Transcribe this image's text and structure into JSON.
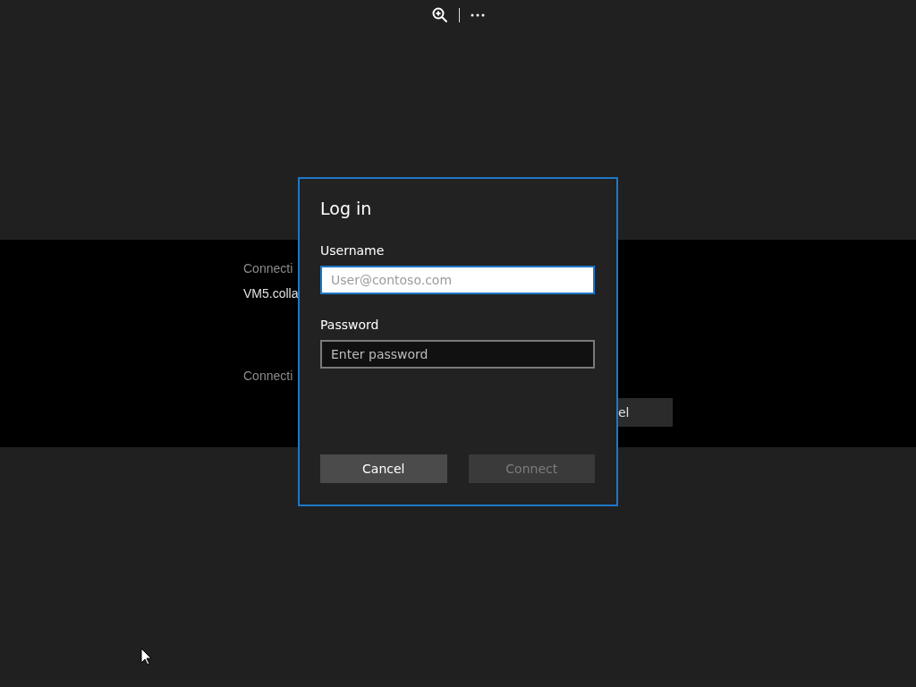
{
  "background": {
    "texts": [
      {
        "text": "Connecti",
        "kind": "label"
      },
      {
        "text": "VM5.colla",
        "kind": "value"
      },
      {
        "text": "Connecti",
        "kind": "label"
      }
    ],
    "button": "el"
  },
  "dialog": {
    "title": "Log in",
    "fields": [
      {
        "label": "Username",
        "placeholder": "User@contoso.com",
        "focused": true
      },
      {
        "label": "Password",
        "placeholder": "Enter password",
        "focused": false
      }
    ],
    "buttons": [
      {
        "label": "Cancel",
        "disabled": false
      },
      {
        "label": "Connect",
        "disabled": true
      }
    ]
  }
}
